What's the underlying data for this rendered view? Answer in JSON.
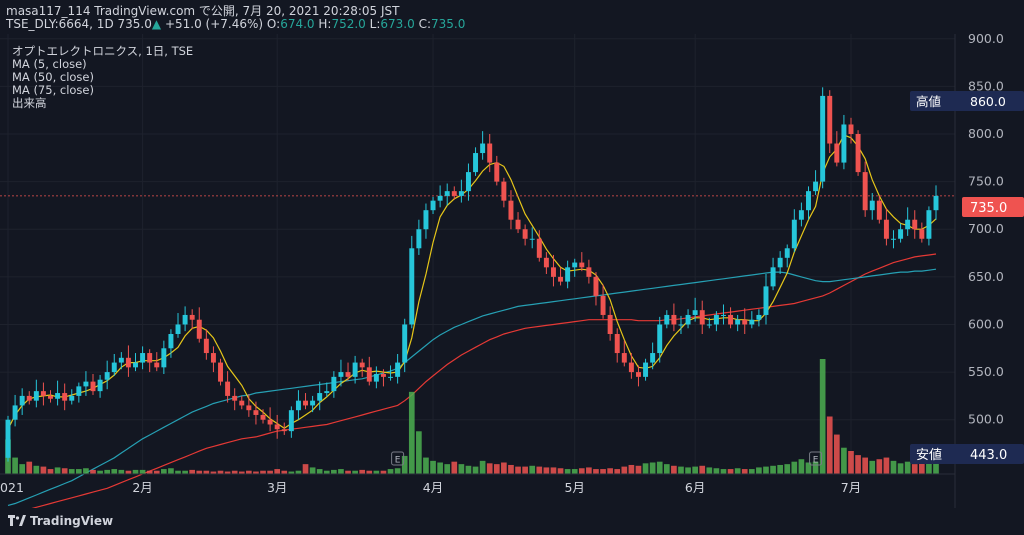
{
  "header": {
    "line1": "masa117_114 TradingView.com で公開, 7月 20, 2021 20:28:05 JST",
    "symbol": "TSE_DLY:6664, 1D",
    "last": "735.0",
    "change_arrow": "▲",
    "change": "+51.0 (+7.46%)",
    "o_label": "O:",
    "o_value": "674.0",
    "h_label": "H:",
    "h_value": "752.0",
    "l_label": "L:",
    "l_value": "673.0",
    "c_label": "C:",
    "c_value": "735.0"
  },
  "legend": {
    "title": "オプトエレクトロニクス, 1日, TSE",
    "ma5": "MA (5, close)",
    "ma50": "MA (50, close)",
    "ma75": "MA (75, close)",
    "volume": "出来高"
  },
  "badges": {
    "high_label": "高値",
    "high_value": "860.0",
    "last_value": "735.0",
    "low_label": "安値",
    "low_value": "443.0"
  },
  "earnings_marker": "E",
  "brand": {
    "name": "TradingView",
    "icon": "tradingview-logo-icon"
  },
  "colors": {
    "background": "#131722",
    "up": "#26c6da",
    "down": "#ef5350",
    "ma5": "#e6c619",
    "ma50": "#26a0b4",
    "ma75": "#e53935",
    "vol_up": "#4caf50",
    "vol_down": "#ef5350"
  },
  "chart_data": {
    "type": "candlestick",
    "title": "オプトエレクトロニクス, 1日, TSE",
    "period": "1D",
    "ylim": [
      443,
      905
    ],
    "y_ticks": [
      500,
      550,
      600,
      650,
      700,
      750,
      800,
      850,
      900
    ],
    "y_tick_labels": [
      "500.0",
      "550.0",
      "600.0",
      "650.0",
      "700.0",
      "750.0",
      "800.0",
      "850.0",
      "900.0"
    ],
    "x_month_labels": [
      {
        "label": "2021",
        "index": 0
      },
      {
        "label": "2月",
        "index": 19
      },
      {
        "label": "3月",
        "index": 38
      },
      {
        "label": "4月",
        "index": 60
      },
      {
        "label": "5月",
        "index": 80
      },
      {
        "label": "6月",
        "index": 97
      },
      {
        "label": "7月",
        "index": 119
      }
    ],
    "earnings_indices": [
      55,
      114
    ],
    "last_price": 735.0,
    "high": 860.0,
    "low": 443.0,
    "closes": [
      500,
      515,
      525,
      520,
      530,
      525,
      522,
      528,
      520,
      525,
      535,
      540,
      530,
      542,
      550,
      560,
      565,
      555,
      560,
      570,
      560,
      555,
      575,
      590,
      600,
      610,
      605,
      585,
      570,
      560,
      540,
      525,
      520,
      515,
      510,
      505,
      500,
      495,
      490,
      488,
      510,
      520,
      515,
      520,
      528,
      530,
      545,
      550,
      545,
      560,
      555,
      540,
      548,
      545,
      545,
      560,
      600,
      680,
      700,
      720,
      730,
      735,
      740,
      735,
      740,
      760,
      780,
      790,
      770,
      750,
      730,
      710,
      700,
      690,
      690,
      670,
      660,
      650,
      645,
      660,
      665,
      660,
      650,
      630,
      610,
      590,
      570,
      560,
      550,
      545,
      560,
      570,
      600,
      610,
      600,
      600,
      610,
      615,
      600,
      600,
      610,
      610,
      600,
      605,
      600,
      605,
      610,
      640,
      660,
      670,
      680,
      710,
      720,
      740,
      750,
      840,
      790,
      770,
      810,
      800,
      760,
      720,
      730,
      710,
      690,
      690,
      700,
      710,
      700,
      690,
      720,
      735
    ],
    "ma5": [
      490,
      505,
      515,
      522,
      524,
      525,
      526,
      524,
      524,
      526,
      528,
      530,
      533,
      537,
      541,
      547,
      555,
      560,
      560,
      562,
      562,
      562,
      565,
      570,
      576,
      588,
      596,
      598,
      594,
      586,
      572,
      556,
      546,
      536,
      522,
      514,
      508,
      501,
      496,
      491,
      496,
      500,
      505,
      510,
      518,
      524,
      531,
      538,
      543,
      549,
      552,
      550,
      551,
      550,
      549,
      550,
      561,
      586,
      624,
      653,
      686,
      713,
      725,
      732,
      736,
      742,
      751,
      761,
      768,
      770,
      766,
      752,
      734,
      716,
      704,
      692,
      679,
      669,
      660,
      656,
      657,
      658,
      657,
      652,
      641,
      626,
      603,
      584,
      567,
      555,
      554,
      556,
      565,
      578,
      588,
      596,
      604,
      607,
      607,
      605,
      606,
      607,
      607,
      605,
      605,
      604,
      604,
      612,
      624,
      639,
      654,
      676,
      693,
      710,
      724,
      759,
      776,
      784,
      799,
      796,
      787,
      774,
      752,
      735,
      721,
      713,
      706,
      704,
      700,
      700,
      704,
      711
    ],
    "ma50": [
      410,
      412,
      415,
      418,
      421,
      424,
      427,
      430,
      433,
      436,
      440,
      444,
      448,
      452,
      456,
      460,
      465,
      470,
      475,
      480,
      484,
      488,
      492,
      496,
      500,
      504,
      508,
      511,
      514,
      517,
      519,
      521,
      523,
      525,
      526,
      528,
      529,
      530,
      531,
      532,
      533,
      534,
      535,
      536,
      537,
      538,
      539,
      540,
      541,
      542,
      543,
      545,
      547,
      549,
      551,
      554,
      560,
      566,
      572,
      578,
      584,
      589,
      593,
      597,
      600,
      603,
      606,
      609,
      611,
      613,
      615,
      617,
      619,
      620,
      621,
      622,
      623,
      624,
      625,
      626,
      627,
      628,
      629,
      630,
      631,
      632,
      633,
      634,
      635,
      636,
      637,
      638,
      639,
      640,
      641,
      642,
      643,
      644,
      645,
      646,
      647,
      648,
      649,
      650,
      651,
      652,
      653,
      654,
      655,
      655,
      654,
      652,
      650,
      648,
      646,
      645,
      645,
      646,
      647,
      648,
      649,
      650,
      651,
      652,
      653,
      654,
      655,
      655,
      656,
      656,
      657,
      658
    ],
    "ma75": [
      400,
      402,
      404,
      406,
      408,
      410,
      412,
      414,
      416,
      418,
      420,
      422,
      424,
      426,
      428,
      431,
      434,
      437,
      440,
      443,
      446,
      449,
      452,
      455,
      458,
      461,
      464,
      467,
      470,
      472,
      474,
      476,
      478,
      480,
      481,
      482,
      484,
      486,
      488,
      489,
      490,
      491,
      492,
      493,
      494,
      495,
      497,
      499,
      501,
      503,
      505,
      507,
      509,
      511,
      513,
      515,
      520,
      526,
      533,
      540,
      546,
      552,
      558,
      563,
      568,
      572,
      576,
      580,
      584,
      587,
      590,
      592,
      594,
      596,
      597,
      598,
      599,
      600,
      601,
      602,
      603,
      604,
      605,
      605,
      605,
      605,
      605,
      605,
      605,
      604,
      604,
      604,
      604,
      605,
      605,
      606,
      607,
      608,
      609,
      610,
      611,
      612,
      613,
      614,
      615,
      616,
      617,
      618,
      619,
      620,
      621,
      622,
      624,
      626,
      628,
      630,
      633,
      637,
      641,
      645,
      649,
      653,
      656,
      659,
      662,
      665,
      667,
      669,
      671,
      672,
      673,
      674
    ],
    "volume": [
      420,
      200,
      120,
      150,
      100,
      90,
      60,
      80,
      70,
      60,
      60,
      70,
      50,
      40,
      50,
      60,
      50,
      40,
      50,
      50,
      40,
      40,
      60,
      70,
      40,
      40,
      50,
      40,
      40,
      30,
      40,
      30,
      40,
      30,
      40,
      30,
      40,
      40,
      60,
      40,
      30,
      40,
      120,
      80,
      60,
      40,
      50,
      60,
      40,
      40,
      50,
      40,
      40,
      40,
      60,
      70,
      220,
      1000,
      520,
      200,
      160,
      140,
      120,
      150,
      120,
      100,
      90,
      160,
      130,
      120,
      140,
      110,
      90,
      90,
      100,
      90,
      80,
      80,
      70,
      60,
      60,
      70,
      80,
      60,
      60,
      70,
      60,
      90,
      110,
      100,
      130,
      140,
      150,
      120,
      100,
      90,
      80,
      90,
      100,
      80,
      70,
      60,
      60,
      70,
      60,
      60,
      80,
      90,
      100,
      110,
      120,
      150,
      180,
      140,
      150,
      1400,
      700,
      480,
      320,
      280,
      230,
      200,
      160,
      180,
      200,
      160,
      130,
      150,
      120,
      230,
      280,
      300
    ]
  }
}
